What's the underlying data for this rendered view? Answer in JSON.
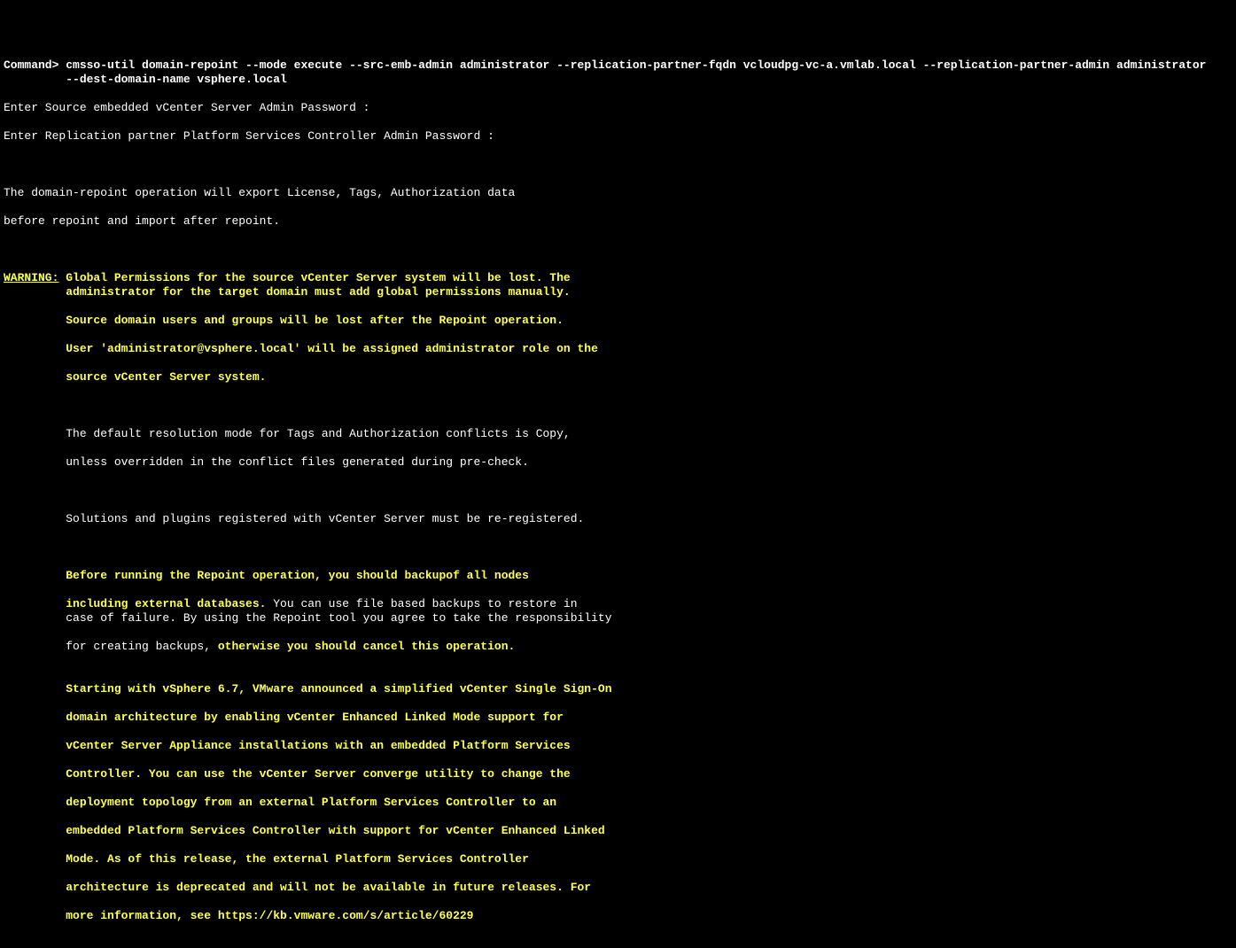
{
  "cmd": {
    "prompt": "Command> ",
    "line1": "cmsso-util domain-repoint --mode execute --src-emb-admin administrator --replication-partner-fqdn vcloudpg-vc-a.vmlab.local --replication-partner-admin administrator",
    "line2": "         --dest-domain-name vsphere.local"
  },
  "prompts": {
    "p1": "Enter Source embedded vCenter Server Admin Password :",
    "p2": "Enter Replication partner Platform Services Controller Admin Password :"
  },
  "info": {
    "l1": "The domain-repoint operation will export License, Tags, Authorization data",
    "l2": "before repoint and import after repoint."
  },
  "warning": {
    "label": "WARNING:",
    "l1": " Global Permissions for the source vCenter Server system will be lost. The",
    "l2": "         administrator for the target domain must add global permissions manually.",
    "l3": "         Source domain users and groups will be lost after the Repoint operation.",
    "l4": "         User 'administrator@vsphere.local' will be assigned administrator role on the",
    "l5": "         source vCenter Server system.",
    "l6a": "         The default resolution mode for Tags and Authorization conflicts is Copy,",
    "l6b": "         unless overridden in the conflict files generated during pre-check.",
    "l7": "         Solutions and plugins registered with vCenter Server must be re-registered.",
    "l8a": "         Before running the Repoint operation, you should backupof all nodes",
    "l8b": "         including external databases.",
    "l8c": " You can use file based backups to restore in",
    "l8d": "         case of failure. By using the Repoint tool you agree to take the responsibility",
    "l8e": "         for creating backups, ",
    "l8f": "otherwise you should cancel this operation.",
    "l9a": "         Starting with vSphere 6.7, VMware announced a simplified vCenter Single Sign-On",
    "l9b": "         domain architecture by enabling vCenter Enhanced Linked Mode support for",
    "l9c": "         vCenter Server Appliance installations with an embedded Platform Services",
    "l9d": "         Controller. You can use the vCenter Server converge utility to change the",
    "l9e": "         deployment topology from an external Platform Services Controller to an",
    "l9f": "         embedded Platform Services Controller with support for vCenter Enhanced Linked",
    "l9g": "         Mode. As of this release, the external Platform Services Controller",
    "l9h": "         architecture is deprecated and will not be available in future releases. For",
    "l9i": "         more information, see https://kb.vmware.com/s/article/60229"
  }
}
